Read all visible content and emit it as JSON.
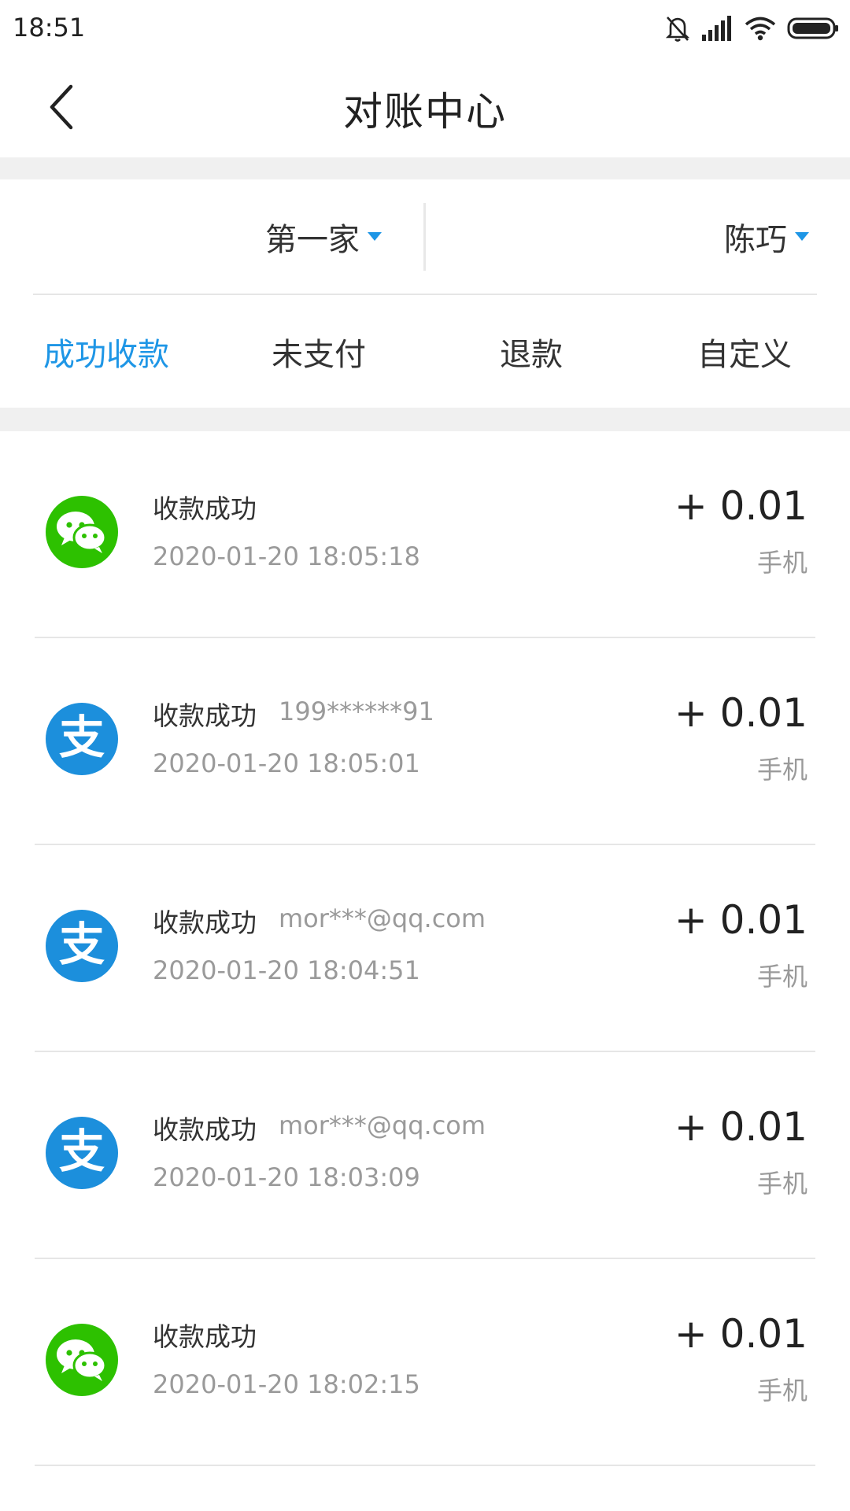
{
  "status_bar": {
    "time": "18:51"
  },
  "header": {
    "title": "对账中心"
  },
  "filters": {
    "store": "第一家",
    "staff": "陈巧"
  },
  "tabs": [
    "成功收款",
    "未支付",
    "退款",
    "自定义"
  ],
  "active_tab": "成功收款",
  "records": [
    {
      "method": "wechat",
      "status": "收款成功",
      "account": "",
      "datetime": "2020-01-20 18:05:18",
      "amount": "+ 0.01",
      "source": "手机"
    },
    {
      "method": "alipay",
      "status": "收款成功",
      "account": "199******91",
      "datetime": "2020-01-20 18:05:01",
      "amount": "+ 0.01",
      "source": "手机"
    },
    {
      "method": "alipay",
      "status": "收款成功",
      "account": "mor***@qq.com",
      "datetime": "2020-01-20 18:04:51",
      "amount": "+ 0.01",
      "source": "手机"
    },
    {
      "method": "alipay",
      "status": "收款成功",
      "account": "mor***@qq.com",
      "datetime": "2020-01-20 18:03:09",
      "amount": "+ 0.01",
      "source": "手机"
    },
    {
      "method": "wechat",
      "status": "收款成功",
      "account": "",
      "datetime": "2020-01-20 18:02:15",
      "amount": "+ 0.01",
      "source": "手机"
    }
  ],
  "icons": {
    "wechat": "wechat-pay-icon",
    "alipay": "alipay-icon",
    "alipay_glyph": "支"
  },
  "colors": {
    "accent": "#1e96e6",
    "wechat": "#2dc100",
    "alipay": "#1c8fdc"
  }
}
